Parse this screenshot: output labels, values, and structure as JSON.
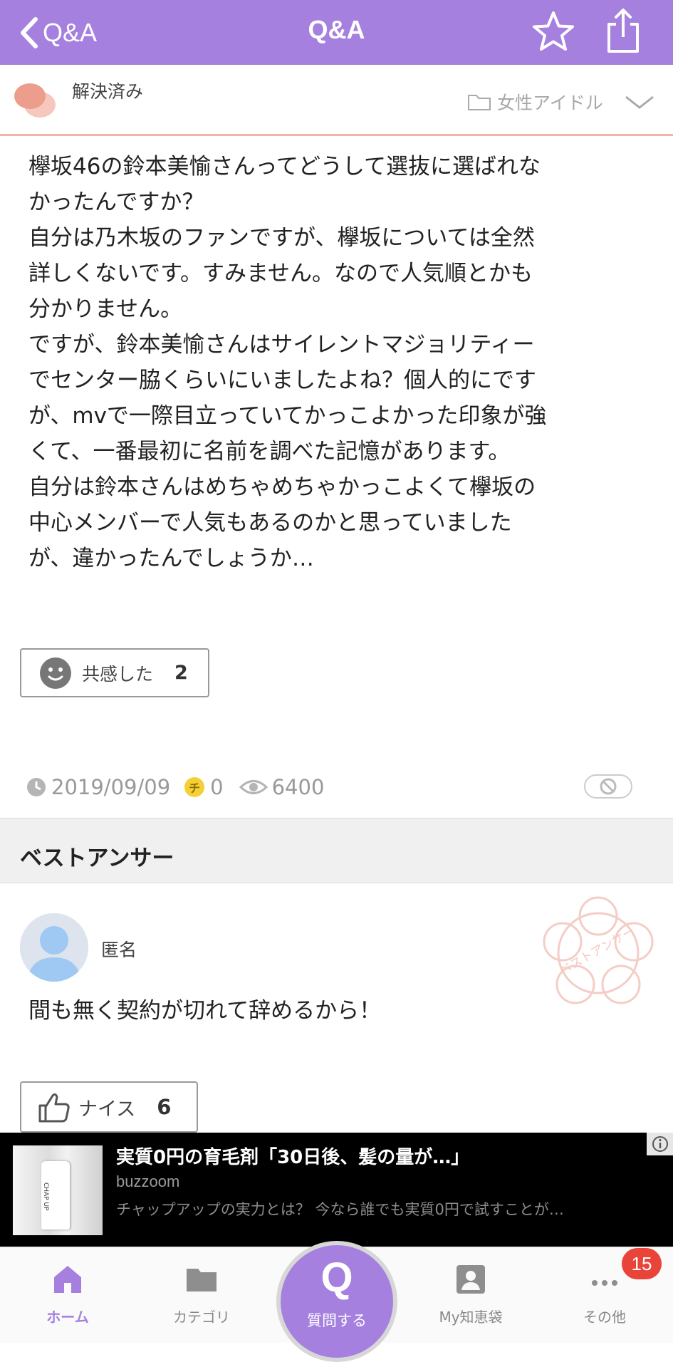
{
  "header": {
    "back_label": "Q&A",
    "title": "Q&A",
    "accent_color": "#a580df"
  },
  "status": {
    "label": "解決済み",
    "category": "女性アイドル"
  },
  "question": {
    "text": "欅坂46の鈴本美愉さんってどうして選抜に選ばれな\nかったんですか？\n自分は乃木坂のファンですが、欅坂については全然\n詳しくないです。すみません。なので人気順とかも\n分かりません。\nですが、鈴本美愉さんはサイレントマジョリティー\nでセンター脇くらいにいましたよね？個人的にです\nが、mvで一際目立っていてかっこよかった印象が強\nくて、一番最初に名前を調べた記憶があります。\n自分は鈴本さんはめちゃめちゃかっこよくて欅坂の\n中心メンバーで人気もあるのかと思っていました\nが、違かったんでしょうか…",
    "empathy_label": "共感した",
    "empathy_count": "2",
    "date": "2019/09/09",
    "coin_symbol": "チ",
    "coins": "0",
    "views": "6400"
  },
  "best_answer": {
    "section_title": "ベストアンサー",
    "user": "匿名",
    "text": "間も無く契約が切れて辞めるから！",
    "stamp_text": "ベストアンサー",
    "nice_label": "ナイス",
    "nice_count": "6"
  },
  "ad": {
    "title": "実質0円の育毛剤「30日後、髪の量が…」",
    "source": "buzzoom",
    "description": "チャップアップの実力とは？ 今なら誰でも実質0円で試すことが…",
    "product_label": "CHAP UP"
  },
  "bottom_nav": {
    "home": "ホーム",
    "category": "カテゴリ",
    "ask_symbol": "Q",
    "ask": "質問する",
    "my": "My知恵袋",
    "other": "その他",
    "badge": "15"
  }
}
